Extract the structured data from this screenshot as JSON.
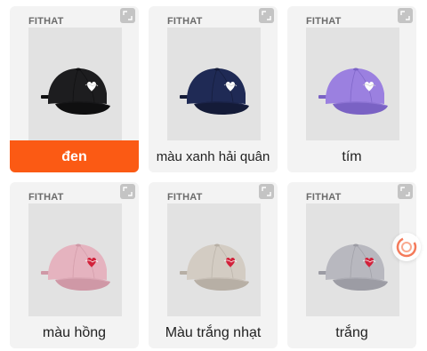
{
  "variants": [
    {
      "brand": "FITHAT",
      "label": "đen",
      "selected": true,
      "cap_color": "#1d1d1f",
      "cap_shadow": "#0f0f10"
    },
    {
      "brand": "FITHAT",
      "label": "màu xanh hải quân",
      "selected": false,
      "cap_color": "#1f2a55",
      "cap_shadow": "#141b38"
    },
    {
      "brand": "FITHAT",
      "label": "tím",
      "selected": false,
      "cap_color": "#9b80e0",
      "cap_shadow": "#7a62c4"
    },
    {
      "brand": "FITHAT",
      "label": "màu hồng",
      "selected": false,
      "cap_color": "#e5b3bf",
      "cap_shadow": "#cf98a6"
    },
    {
      "brand": "FITHAT",
      "label": "Màu trắng nhạt",
      "selected": false,
      "cap_color": "#d3ccc3",
      "cap_shadow": "#b7afa5"
    },
    {
      "brand": "FITHAT",
      "label": "trắng",
      "selected": false,
      "cap_color": "#b8b8bf",
      "cap_shadow": "#9c9ca4"
    }
  ],
  "colors": {
    "selected_bg": "#fb5a14",
    "card_bg": "#f3f3f3",
    "badge_accent": "#f47a5a"
  },
  "icons": {
    "zoom": "expand-icon",
    "floating": "refresh-badge-icon"
  }
}
